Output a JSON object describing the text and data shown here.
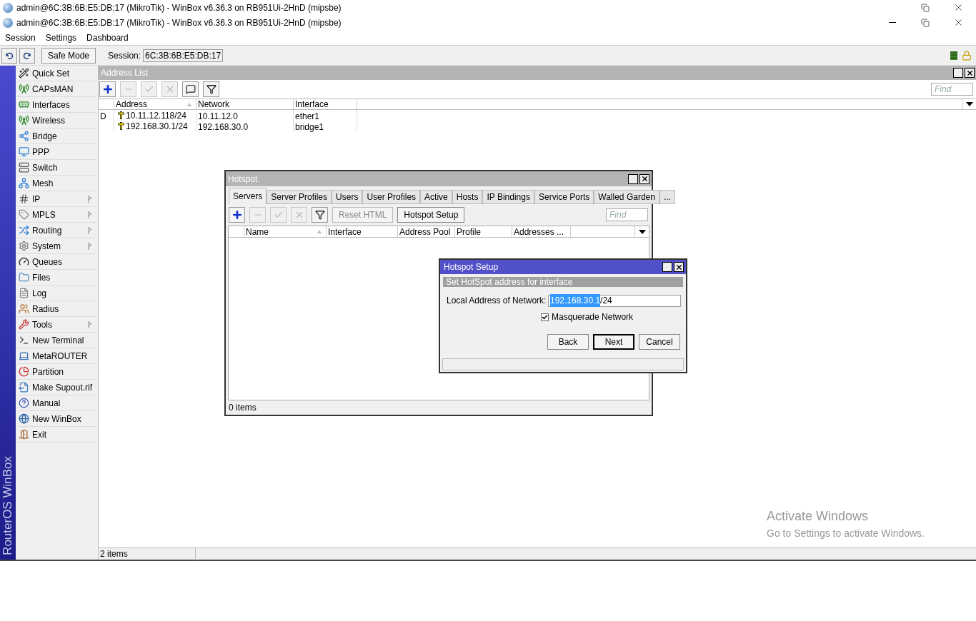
{
  "title_bars": [
    {
      "title": "admin@6C:3B:6B:E5:DB:17 (MikroTik) - WinBox v6.36.3 on RB951Ui-2HnD (mipsbe)",
      "controls": [
        {
          "kind": "restore"
        },
        {
          "kind": "close"
        }
      ]
    },
    {
      "title": "admin@6C:3B:6B:E5:DB:17 (MikroTik) - WinBox v6.36.3 on RB951Ui-2HnD (mipsbe)",
      "controls": [
        {
          "kind": "minimize"
        },
        {
          "kind": "restore"
        },
        {
          "kind": "close"
        }
      ]
    }
  ],
  "menu": [
    "Session",
    "Settings",
    "Dashboard"
  ],
  "toolbar": {
    "safe_mode": "Safe Mode",
    "session_label": "Session:",
    "session_value": "6C:3B:6B:E5:DB:17"
  },
  "sidebar": {
    "brand": "RouterOS WinBox",
    "items": [
      {
        "label": "Quick Set",
        "submenu": false
      },
      {
        "label": "CAPsMAN",
        "submenu": false
      },
      {
        "label": "Interfaces",
        "submenu": false
      },
      {
        "label": "Wireless",
        "submenu": false
      },
      {
        "label": "Bridge",
        "submenu": false
      },
      {
        "label": "PPP",
        "submenu": false
      },
      {
        "label": "Switch",
        "submenu": false
      },
      {
        "label": "Mesh",
        "submenu": false
      },
      {
        "label": "IP",
        "submenu": true
      },
      {
        "label": "MPLS",
        "submenu": true
      },
      {
        "label": "Routing",
        "submenu": true
      },
      {
        "label": "System",
        "submenu": true
      },
      {
        "label": "Queues",
        "submenu": false
      },
      {
        "label": "Files",
        "submenu": false
      },
      {
        "label": "Log",
        "submenu": false
      },
      {
        "label": "Radius",
        "submenu": false
      },
      {
        "label": "Tools",
        "submenu": true
      },
      {
        "label": "New Terminal",
        "submenu": false
      },
      {
        "label": "MetaROUTER",
        "submenu": false
      },
      {
        "label": "Partition",
        "submenu": false
      },
      {
        "label": "Make Supout.rif",
        "submenu": false
      },
      {
        "label": "Manual",
        "submenu": false
      },
      {
        "label": "New WinBox",
        "submenu": false
      },
      {
        "label": "Exit",
        "submenu": false
      }
    ]
  },
  "address_list": {
    "title": "Address List",
    "tools": [
      {
        "kind": "add",
        "disabled": false
      },
      {
        "kind": "remove",
        "disabled": true
      },
      {
        "kind": "enable",
        "disabled": true
      },
      {
        "kind": "disable",
        "disabled": true
      },
      {
        "kind": "comment",
        "disabled": false
      },
      {
        "kind": "filter",
        "disabled": false
      }
    ],
    "find_placeholder": "Find",
    "columns": [
      {
        "label": "Address",
        "sorted": true
      },
      {
        "label": "Network",
        "sorted": false
      },
      {
        "label": "Interface",
        "sorted": false
      }
    ],
    "rows": [
      {
        "flag": "D",
        "address": "10.11.12.118/24",
        "network": "10.11.12.0",
        "interface": "ether1"
      },
      {
        "flag": "",
        "address": "192.168.30.1/24",
        "network": "192.168.30.0",
        "interface": "bridge1"
      }
    ],
    "status": "2 items"
  },
  "hotspot": {
    "title": "Hotspot",
    "tabs": [
      {
        "label": "Servers",
        "selected": true
      },
      {
        "label": "Server Profiles",
        "selected": false
      },
      {
        "label": "Users",
        "selected": false
      },
      {
        "label": "User Profiles",
        "selected": false
      },
      {
        "label": "Active",
        "selected": false
      },
      {
        "label": "Hosts",
        "selected": false
      },
      {
        "label": "IP Bindings",
        "selected": false
      },
      {
        "label": "Service Ports",
        "selected": false
      },
      {
        "label": "Walled Garden",
        "selected": false
      },
      {
        "label": "...",
        "selected": false
      }
    ],
    "tools": [
      {
        "kind": "add",
        "disabled": false
      },
      {
        "kind": "remove",
        "disabled": true
      },
      {
        "kind": "enable",
        "disabled": true
      },
      {
        "kind": "disable",
        "disabled": true
      },
      {
        "kind": "filter",
        "disabled": false
      }
    ],
    "buttons": [
      {
        "label": "Reset HTML",
        "disabled": true
      },
      {
        "label": "Hotspot Setup",
        "disabled": false
      }
    ],
    "find_placeholder": "Find",
    "columns": [
      {
        "label": "Name",
        "sorted": true
      },
      {
        "label": "Interface",
        "sorted": false
      },
      {
        "label": "Address Pool",
        "sorted": false
      },
      {
        "label": "Profile",
        "sorted": false
      },
      {
        "label": "Addresses ...",
        "sorted": false
      }
    ],
    "status": "0 items"
  },
  "hotspot_setup": {
    "title": "Hotspot Setup",
    "section": "Set HotSpot address for interface",
    "field_label": "Local Address of Network:",
    "field_value_selected": "192.168.30.1",
    "field_value_rest": "/24",
    "masquerade": {
      "label": "Masquerade Network",
      "checked": true
    },
    "buttons": [
      {
        "label": "Back",
        "default": false
      },
      {
        "label": "Next",
        "default": true
      },
      {
        "label": "Cancel",
        "default": false
      }
    ]
  },
  "os_notice": {
    "title": "Activate Windows",
    "text": "Go to Settings to activate Windows."
  }
}
